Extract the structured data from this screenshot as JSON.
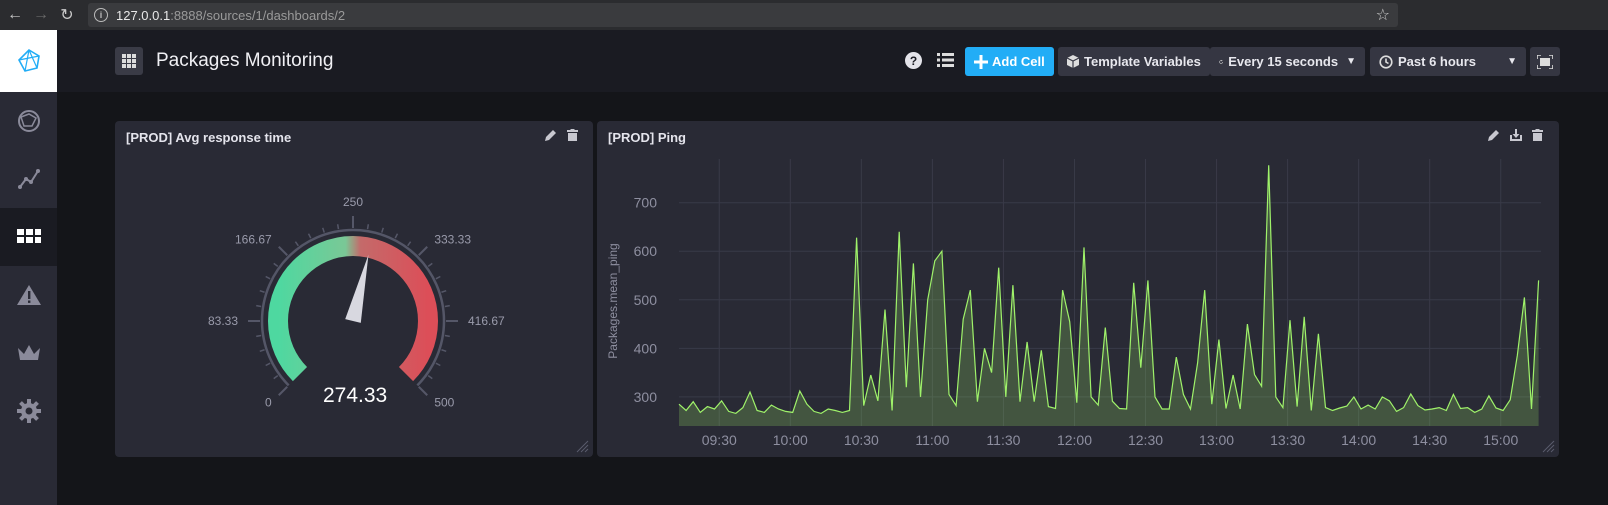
{
  "browser": {
    "url_host": "127.0.0.1",
    "url_rest": ":8888/sources/1/dashboards/2"
  },
  "header": {
    "title": "Packages Monitoring",
    "help_label": "?",
    "add_cell_label": "Add Cell",
    "template_variables_label": "Template Variables",
    "refresh_label": "Every 15 seconds",
    "time_range_label": "Past 6 hours"
  },
  "sidebar": {
    "items": [
      "logo",
      "data-explorer",
      "graph",
      "dashboards",
      "alerts",
      "admin",
      "settings"
    ],
    "active": "dashboards"
  },
  "gauge_panel": {
    "title": "[PROD] Avg response time",
    "value": "274.33",
    "min": 0,
    "max": 500,
    "ticks": [
      "0",
      "83.33",
      "166.67",
      "250",
      "333.33",
      "416.67",
      "500"
    ],
    "colors": {
      "low": "#4ed8a0",
      "high": "#dc4e58"
    }
  },
  "ping_panel": {
    "title": "[PROD] Ping",
    "ylabel": "Packages.mean_ping",
    "line_color": "#9ff26a"
  },
  "chart_data": {
    "type": "line",
    "title": "[PROD] Ping",
    "ylabel": "Packages.mean_ping",
    "xlabel": "",
    "x_ticks": [
      "09:30",
      "10:00",
      "10:30",
      "11:00",
      "11:30",
      "12:00",
      "12:30",
      "13:00",
      "13:30",
      "14:00",
      "14:30",
      "15:00"
    ],
    "y_ticks": [
      300,
      400,
      500,
      600,
      700
    ],
    "ylim": [
      240,
      790
    ],
    "xlim": [
      "09:13",
      "15:17"
    ],
    "grid": true,
    "series": [
      {
        "x": [
          "09:13",
          "09:16",
          "09:19",
          "09:22",
          "09:25",
          "09:28",
          "09:31",
          "09:34",
          "09:37",
          "09:40",
          "09:43",
          "09:46",
          "09:49",
          "09:52",
          "09:55",
          "09:58",
          "10:01",
          "10:04",
          "10:07",
          "10:10",
          "10:13",
          "10:16",
          "10:19",
          "10:22",
          "10:25",
          "10:28",
          "10:31",
          "10:34",
          "10:37",
          "10:40",
          "10:43",
          "10:46",
          "10:49",
          "10:52",
          "10:55",
          "10:58",
          "11:01",
          "11:04",
          "11:07",
          "11:10",
          "11:13",
          "11:16",
          "11:19",
          "11:22",
          "11:25",
          "11:28",
          "11:31",
          "11:34",
          "11:37",
          "11:40",
          "11:43",
          "11:46",
          "11:49",
          "11:52",
          "11:55",
          "11:58",
          "12:01",
          "12:04",
          "12:07",
          "12:10",
          "12:13",
          "12:16",
          "12:19",
          "12:22",
          "12:25",
          "12:28",
          "12:31",
          "12:34",
          "12:37",
          "12:40",
          "12:43",
          "12:46",
          "12:49",
          "12:52",
          "12:55",
          "12:58",
          "13:01",
          "13:04",
          "13:07",
          "13:10",
          "13:13",
          "13:16",
          "13:19",
          "13:22",
          "13:25",
          "13:28",
          "13:31",
          "13:34",
          "13:37",
          "13:40",
          "13:43",
          "13:46",
          "13:49",
          "13:52",
          "13:55",
          "13:58",
          "14:01",
          "14:04",
          "14:07",
          "14:10",
          "14:13",
          "14:16",
          "14:19",
          "14:22",
          "14:25",
          "14:28",
          "14:31",
          "14:34",
          "14:37",
          "14:40",
          "14:43",
          "14:46",
          "14:49",
          "14:52",
          "14:55",
          "14:58",
          "15:01",
          "15:04",
          "15:07",
          "15:10",
          "15:13",
          "15:16"
        ],
        "y": [
          285,
          272,
          290,
          268,
          280,
          275,
          292,
          270,
          266,
          278,
          310,
          272,
          268,
          283,
          275,
          270,
          268,
          312,
          285,
          270,
          266,
          275,
          272,
          268,
          272,
          628,
          282,
          345,
          292,
          480,
          272,
          640,
          320,
          575,
          300,
          500,
          580,
          600,
          305,
          282,
          460,
          520,
          290,
          400,
          350,
          566,
          300,
          530,
          290,
          413,
          290,
          396,
          280,
          276,
          520,
          455,
          288,
          608,
          300,
          283,
          443,
          291,
          276,
          275,
          535,
          360,
          540,
          300,
          275,
          275,
          382,
          305,
          275,
          370,
          520,
          285,
          418,
          276,
          345,
          275,
          450,
          346,
          322,
          777,
          300,
          278,
          458,
          280,
          465,
          272,
          430,
          278,
          272,
          277,
          281,
          300,
          275,
          283,
          275,
          300,
          292,
          270,
          278,
          306,
          282,
          273,
          275,
          278,
          272,
          305,
          276,
          278,
          268,
          275,
          302,
          277,
          272,
          294,
          385,
          505,
          275,
          540
        ],
        "name": ""
      }
    ]
  },
  "gauge_data": {
    "type": "gauge",
    "value": 274.33,
    "range": [
      0,
      500
    ],
    "tick_labels": [
      "0",
      "83.33",
      "166.67",
      "250",
      "333.33",
      "416.67",
      "500"
    ]
  }
}
